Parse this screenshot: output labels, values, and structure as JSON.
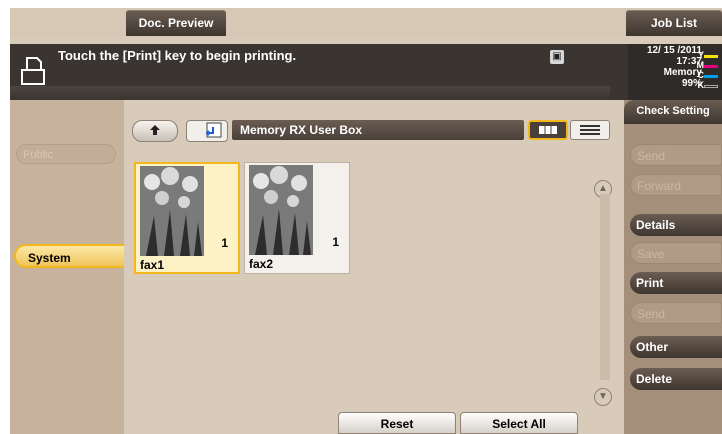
{
  "top_buttons": {
    "doc_preview": "Doc. Preview",
    "job_list": "Job List"
  },
  "status": {
    "message": "Touch the [Print] key to begin printing.",
    "date": "12/ 15 /2011",
    "time": "17:37",
    "memory_label": "Memory",
    "memory_value": "99%",
    "toner": [
      {
        "letter": "Y",
        "color": "#f7e10a"
      },
      {
        "letter": "M",
        "color": "#e4007f"
      },
      {
        "letter": "C",
        "color": "#00a0e9"
      },
      {
        "letter": "K",
        "color": "#222222"
      }
    ]
  },
  "left": {
    "public_tab": "Public",
    "system_tab": "System"
  },
  "main": {
    "box_title": "Memory RX User Box",
    "documents": [
      {
        "name": "fax1",
        "count": "1",
        "selected": true
      },
      {
        "name": "fax2",
        "count": "1",
        "selected": false
      }
    ],
    "reset": "Reset",
    "select_all": "Select All"
  },
  "right": {
    "check_setting": "Check Setting",
    "items": [
      {
        "label": "Send",
        "enabled": false
      },
      {
        "label": "Forward",
        "enabled": false
      },
      {
        "label": "Details",
        "enabled": true
      },
      {
        "label": "Save",
        "enabled": false
      },
      {
        "label": "Print",
        "enabled": true
      },
      {
        "label": "Send",
        "enabled": false
      },
      {
        "label": "Other",
        "enabled": true
      },
      {
        "label": "Delete",
        "enabled": true
      }
    ]
  }
}
